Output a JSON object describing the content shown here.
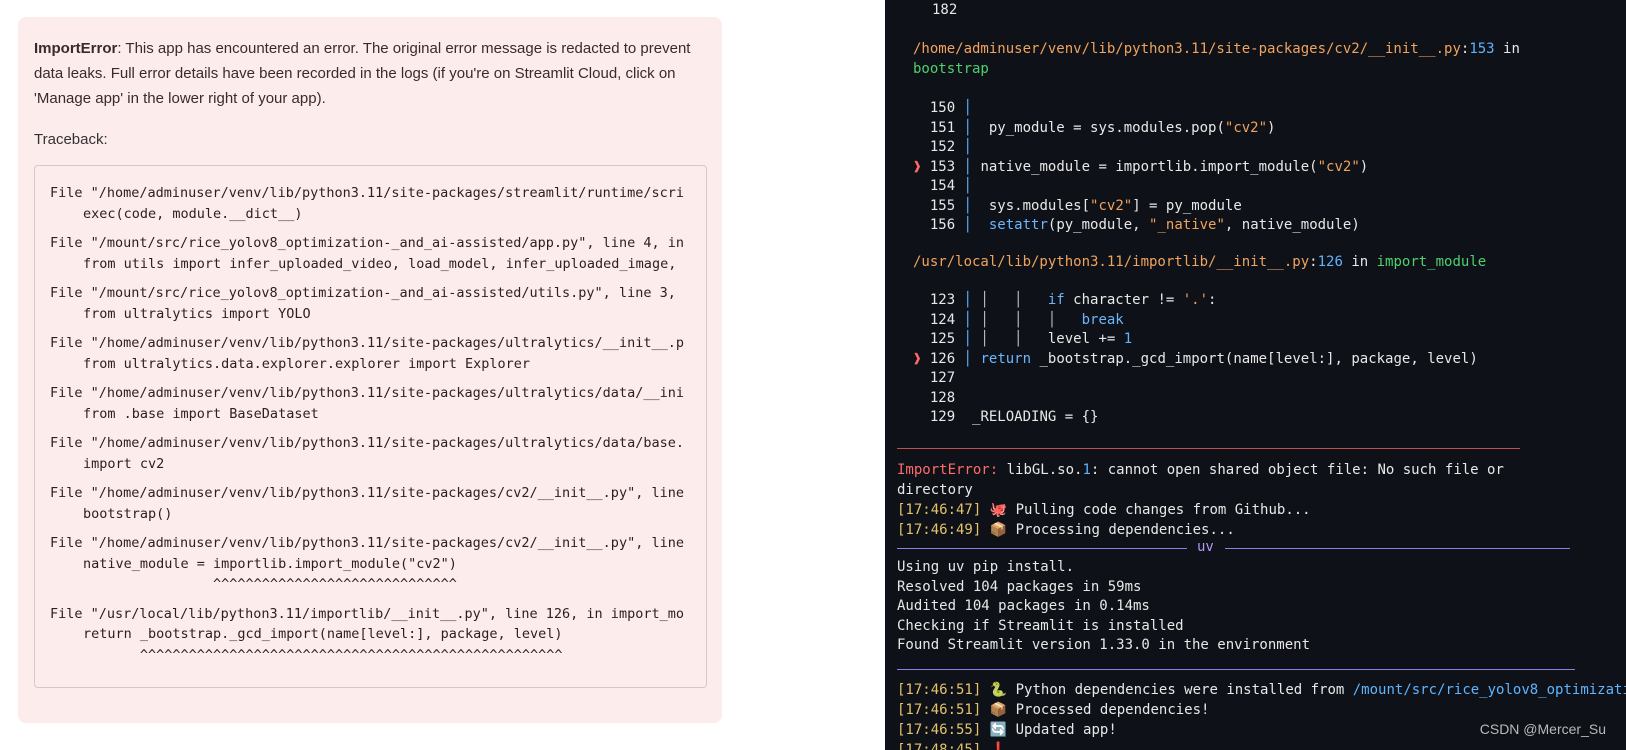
{
  "error_panel": {
    "error_type": "ImportError",
    "message": ": This app has encountered an error. The original error message is redacted to prevent data leaks. Full error details have been recorded in the logs (if you're on Streamlit Cloud, click on 'Manage app' in the lower right of your app).",
    "traceback_label": "Traceback:",
    "trace": [
      {
        "file": "File \"/home/adminuser/venv/lib/python3.11/site-packages/streamlit/runtime/scri",
        "code": [
          "exec(code, module.__dict__)"
        ]
      },
      {
        "file": "File \"/mount/src/rice_yolov8_optimization-_and_ai-assisted/app.py\", line 4, in",
        "code": [
          "from utils import infer_uploaded_video, load_model, infer_uploaded_image,"
        ]
      },
      {
        "file": "File \"/mount/src/rice_yolov8_optimization-_and_ai-assisted/utils.py\", line 3,",
        "code": [
          "from ultralytics import YOLO"
        ]
      },
      {
        "file": "File \"/home/adminuser/venv/lib/python3.11/site-packages/ultralytics/__init__.p",
        "code": [
          "from ultralytics.data.explorer.explorer import Explorer"
        ]
      },
      {
        "file": "File \"/home/adminuser/venv/lib/python3.11/site-packages/ultralytics/data/__ini",
        "code": [
          "from .base import BaseDataset"
        ]
      },
      {
        "file": "File \"/home/adminuser/venv/lib/python3.11/site-packages/ultralytics/data/base.",
        "code": [
          "import cv2"
        ]
      },
      {
        "file": "File \"/home/adminuser/venv/lib/python3.11/site-packages/cv2/__init__.py\", line",
        "code": [
          "bootstrap()"
        ]
      },
      {
        "file": "File \"/home/adminuser/venv/lib/python3.11/site-packages/cv2/__init__.py\", line",
        "code": [
          "native_module = importlib.import_module(\"cv2\")",
          "                ^^^^^^^^^^^^^^^^^^^^^^^^^^^^^^"
        ]
      },
      {
        "file": "File \"/usr/local/lib/python3.11/importlib/__init__.py\", line 126, in import_mo",
        "code": [
          "return _bootstrap._gcd_import(name[level:], package, level)",
          "       ^^^^^^^^^^^^^^^^^^^^^^^^^^^^^^^^^^^^^^^^^^^^^^^^^^^^"
        ]
      }
    ]
  },
  "terminal": {
    "top_line_number": "182",
    "frame1": {
      "path": "/home/adminuser/venv/lib/python3.11/site-packages/cv2/__init__.py",
      "sep": ":",
      "line": "153",
      "in": " in",
      "func": "bootstrap"
    },
    "frame1_lines": [
      {
        "num": "150",
        "code": ""
      },
      {
        "num": "151",
        "code": "  py_module = sys.modules.pop(",
        "str": "\"cv2\"",
        "tail": ")"
      },
      {
        "num": "152",
        "code": ""
      },
      {
        "num": "153",
        "code": " native_module = importlib.import_module(",
        "str": "\"cv2\"",
        "tail": ")",
        "marker": "❱"
      },
      {
        "num": "154",
        "code": ""
      },
      {
        "num": "155",
        "code": "  sys.modules[",
        "str": "\"cv2\"",
        "tail": "] = py_module"
      },
      {
        "num": "156",
        "code": "  ",
        "kw": "setattr",
        "tail": "(py_module, ",
        "str2": "\"_native\"",
        "tail2": ", native_module)"
      }
    ],
    "frame2": {
      "path": "/usr/local/lib/python3.11/importlib/__init__.py",
      "sep": ":",
      "line": "126",
      "in": " in ",
      "func": "import_module"
    },
    "frame2_lines": [
      {
        "num": "123",
        "pre": " │   │   ",
        "kw": "if",
        "mid": " character != ",
        "str": "'.'",
        "tail": ":"
      },
      {
        "num": "124",
        "pre": " │   │   │   ",
        "kw": "break",
        "mid": "",
        "str": "",
        "tail": ""
      },
      {
        "num": "125",
        "pre": " │   │   ",
        "kw": "",
        "mid": "level += ",
        "str": "",
        "num_lit": "1",
        "tail": ""
      },
      {
        "num": "126",
        "pre": " ",
        "kw": "return",
        "mid": " _bootstrap._gcd_import(name[level:], package, level)",
        "str": "",
        "tail": "",
        "marker": "❱"
      },
      {
        "num": "127",
        "pre": "",
        "kw": "",
        "mid": "",
        "str": "",
        "tail": ""
      },
      {
        "num": "128",
        "pre": "",
        "kw": "",
        "mid": "",
        "str": "",
        "tail": ""
      },
      {
        "num": "129",
        "pre": "",
        "kw": "",
        "mid": "_RELOADING = {}",
        "str": "",
        "tail": ""
      }
    ],
    "import_error": {
      "label": "ImportError:",
      "text1": " libGL.so.",
      "num": "1",
      "text2": ": cannot open shared object file: No such file or",
      "text3": "directory"
    },
    "log1": {
      "time": "[17:46:47]",
      "icon": "🐙",
      "text": " Pulling code changes from Github..."
    },
    "log2": {
      "time": "[17:46:49]",
      "icon": "📦",
      "text": " Processing dependencies..."
    },
    "uv_label": "uv",
    "uv_lines": [
      "Using uv pip install.",
      "Resolved 104 packages in 59ms",
      "Audited 104 packages in 0.14ms",
      "Checking if Streamlit is installed",
      "Found Streamlit version 1.33.0 in the environment"
    ],
    "log3": {
      "time": "[17:46:51]",
      "icon": "🐍",
      "text": " Python dependencies were installed from ",
      "path": "/mount/src/rice_yolov8_optimizati"
    },
    "log4": {
      "time": "[17:46:51]",
      "icon": "📦",
      "text": " Processed dependencies!"
    },
    "log5": {
      "time": "[17:46:55]",
      "icon": "🔄",
      "text": " Updated app!"
    },
    "log6": {
      "time": "[17:48:45]",
      "icon": "❗",
      "text": ""
    }
  },
  "watermark": "CSDN @Mercer_Su",
  "colors": {
    "panel_bg": "#fdecec",
    "terminal_bg": "#0e1117",
    "path_orange": "#f0a35e",
    "line_blue": "#5fb4ff",
    "func_green": "#4fd16d"
  }
}
